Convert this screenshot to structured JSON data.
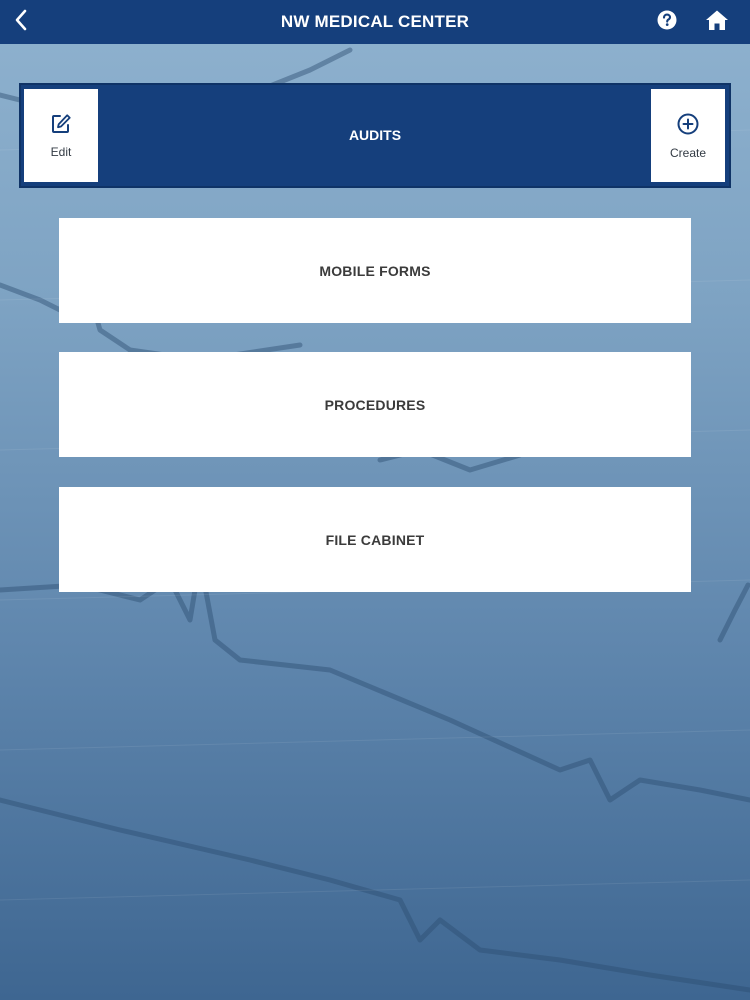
{
  "header": {
    "title": "NW MEDICAL CENTER",
    "back_icon": "chevron-left-icon",
    "help_icon": "question-circle-icon",
    "home_icon": "home-icon"
  },
  "audits_bar": {
    "label": "AUDITS",
    "edit": {
      "label": "Edit",
      "icon": "edit-icon"
    },
    "create": {
      "label": "Create",
      "icon": "plus-circle-icon"
    }
  },
  "menu": [
    {
      "label": "MOBILE FORMS"
    },
    {
      "label": "PROCEDURES"
    },
    {
      "label": "FILE CABINET"
    }
  ],
  "colors": {
    "primary": "#153f7c",
    "card_bg": "#ffffff",
    "card_text": "#3b3b3b"
  }
}
